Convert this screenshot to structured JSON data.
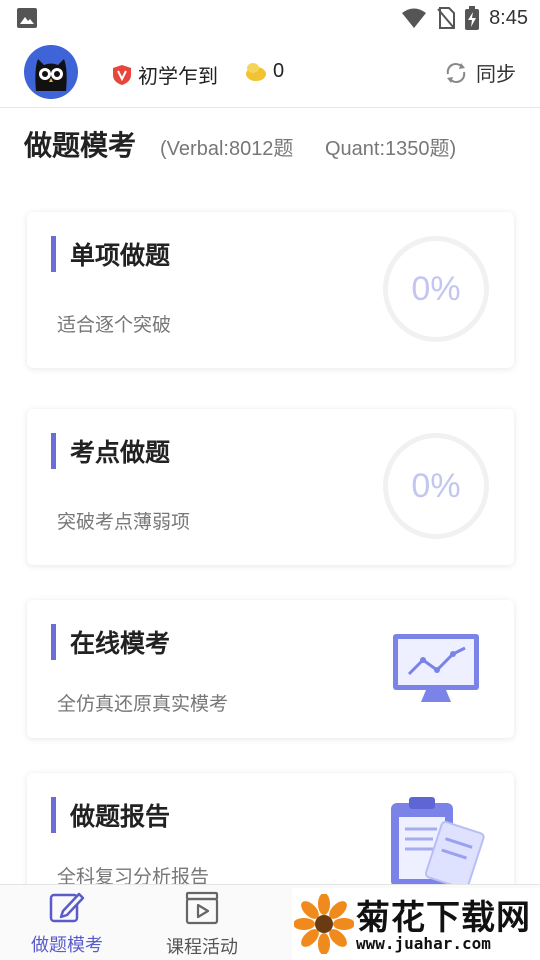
{
  "status_bar": {
    "time": "8:45",
    "icons": [
      "image-icon",
      "wifi-icon",
      "no-sim-icon",
      "battery-charging-icon"
    ]
  },
  "header": {
    "avatar_icon": "owl-avatar-icon",
    "level_badge_icon": "v-shield-icon",
    "level_label": "初学乍到",
    "coin_icon": "gold-coin-icon",
    "coins": "0",
    "sync_icon": "sync-icon",
    "sync_label": "同步"
  },
  "page": {
    "title": "做题模考",
    "verbal_count": "(Verbal:8012题",
    "quant_count": "Quant:1350题)"
  },
  "cards": [
    {
      "title": "单项做题",
      "desc": "适合逐个突破",
      "progress": "0%"
    },
    {
      "title": "考点做题",
      "desc": "突破考点薄弱项",
      "progress": "0%"
    },
    {
      "title": "在线模考",
      "desc": "全仿真还原真实模考",
      "icon": "monitor-chart-icon"
    },
    {
      "title": "做题报告",
      "desc": "全科复习分析报告",
      "icon": "clipboard-report-icon"
    }
  ],
  "bottom_nav": [
    {
      "label": "做题模考",
      "icon": "edit-icon",
      "active": true
    },
    {
      "label": "课程活动",
      "icon": "video-play-icon",
      "active": false
    }
  ],
  "watermark": {
    "name": "菊花下载网",
    "url": "www.juahar.com"
  },
  "colors": {
    "accent": "#6a6cd8",
    "ring_text": "#c3c6ef",
    "avatar_bg": "#3f64d8",
    "badge_red": "#e8463c",
    "coin_yellow": "#f2c230"
  }
}
